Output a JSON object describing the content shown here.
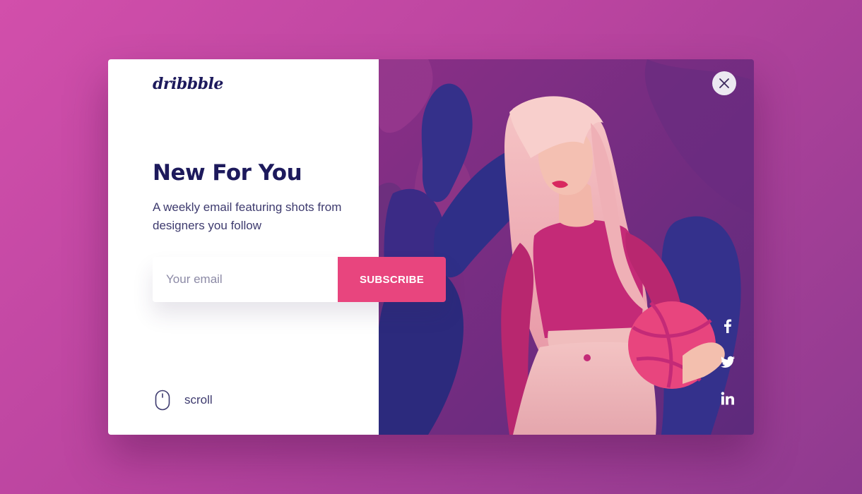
{
  "brand": {
    "logo_text": "dribbble"
  },
  "hero": {
    "title": "New For You",
    "subtitle": "A weekly email featuring shots from designers you follow"
  },
  "form": {
    "email_placeholder": "Your email",
    "email_value": "",
    "subscribe_label": "SUBSCRIBE"
  },
  "scroll": {
    "label": "scroll",
    "icon": "mouse-icon"
  },
  "social": [
    {
      "name": "facebook",
      "icon": "facebook-icon"
    },
    {
      "name": "twitter",
      "icon": "twitter-icon"
    },
    {
      "name": "linkedin",
      "icon": "linkedin-icon"
    }
  ],
  "close": {
    "icon": "close-icon"
  },
  "colors": {
    "background_start": "#d24fab",
    "background_end": "#8e3a8f",
    "text_primary": "#1d1a5c",
    "text_secondary": "#3d3a6e",
    "accent": "#e8457e",
    "illustration_bg": "#7a2f86"
  }
}
